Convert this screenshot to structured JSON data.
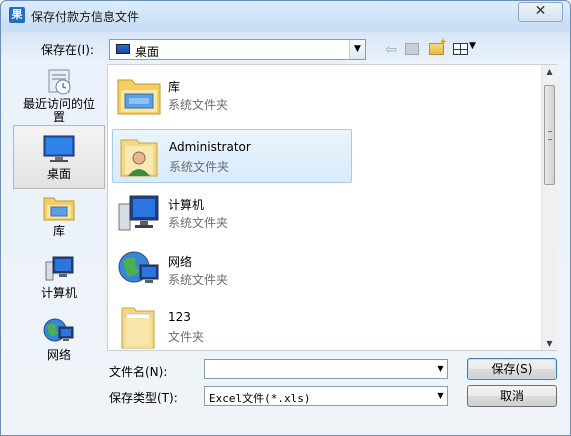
{
  "window": {
    "title": "保存付款方信息文件",
    "app_icon_glyph": "果",
    "close_glyph": "✕"
  },
  "lookin": {
    "label": "保存在(I):",
    "value": "桌面"
  },
  "toolbar": {
    "back_glyph": "⇦",
    "view_arrow_glyph": "▼"
  },
  "places": [
    {
      "label": "最近访问的位置",
      "icon": "recent-places-icon"
    },
    {
      "label": "桌面",
      "icon": "desktop-icon",
      "selected": true
    },
    {
      "label": "库",
      "icon": "libraries-icon"
    },
    {
      "label": "计算机",
      "icon": "computer-icon"
    },
    {
      "label": "网络",
      "icon": "network-icon"
    }
  ],
  "files": [
    {
      "name": "库",
      "type": "系统文件夹",
      "icon": "libraries-folder-icon"
    },
    {
      "name": "Administrator",
      "type": "系统文件夹",
      "icon": "user-folder-icon",
      "selected": true
    },
    {
      "name": "计算机",
      "type": "系统文件夹",
      "icon": "computer-icon"
    },
    {
      "name": "网络",
      "type": "系统文件夹",
      "icon": "network-icon"
    },
    {
      "name": "123",
      "type": "文件夹",
      "icon": "folder-icon"
    }
  ],
  "filename": {
    "label": "文件名(N):",
    "value": ""
  },
  "filetype": {
    "label": "保存类型(T):",
    "value": "Excel文件(*.xls)"
  },
  "buttons": {
    "save": "保存(S)",
    "cancel": "取消"
  }
}
